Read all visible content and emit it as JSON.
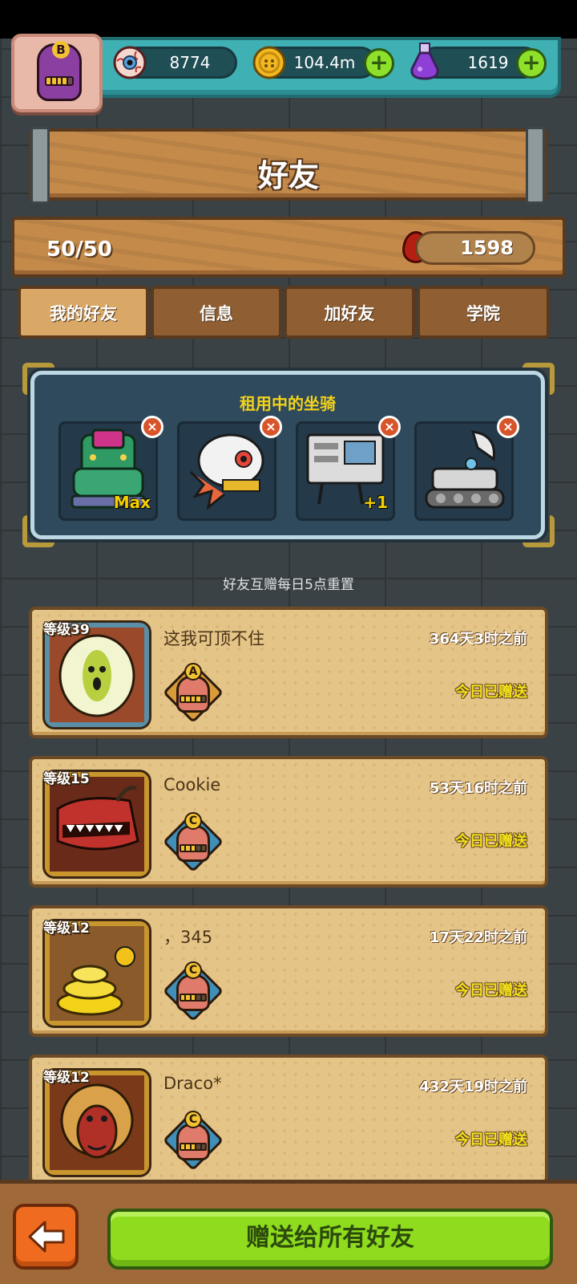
{
  "top_bar": {
    "rank_letter": "B",
    "eyeballs": "8774",
    "coins": "104.4m",
    "potions": "1619",
    "plus_label": "+"
  },
  "header": {
    "title": "好友"
  },
  "stats": {
    "friend_count": "50/50",
    "blood": "1598"
  },
  "tabs": [
    {
      "label": "我的好友",
      "active": true
    },
    {
      "label": "信息",
      "active": false
    },
    {
      "label": "加好友",
      "active": false
    },
    {
      "label": "学院",
      "active": false
    }
  ],
  "mounts": {
    "title": "租用中的坐骑",
    "slots": [
      {
        "badge": "Max"
      },
      {
        "badge": ""
      },
      {
        "badge": "+1"
      },
      {
        "badge": ""
      }
    ],
    "remove_label": "×"
  },
  "reset_note": "好友互赠每日5点重置",
  "friends": [
    {
      "level": "等级39",
      "name": "这我可顶不住",
      "time": "364天3时之前",
      "gift_status": "今日已赠送",
      "rank": "A"
    },
    {
      "level": "等级15",
      "name": "Cookie",
      "time": "53天16时之前",
      "gift_status": "今日已赠送",
      "rank": "C"
    },
    {
      "level": "等级12",
      "name": "，345",
      "time": "17天22时之前",
      "gift_status": "今日已赠送",
      "rank": "C"
    },
    {
      "level": "等级12",
      "name": "Draco*",
      "time": "432天19时之前",
      "gift_status": "今日已赠送",
      "rank": "C"
    }
  ],
  "footer": {
    "gift_all_label": "赠送给所有好友"
  },
  "colors": {
    "accent_green": "#8fdc1f",
    "wood": "#c48a4a",
    "panel_blue": "#2f4a5c",
    "gift_yellow": "#f3e21a"
  }
}
